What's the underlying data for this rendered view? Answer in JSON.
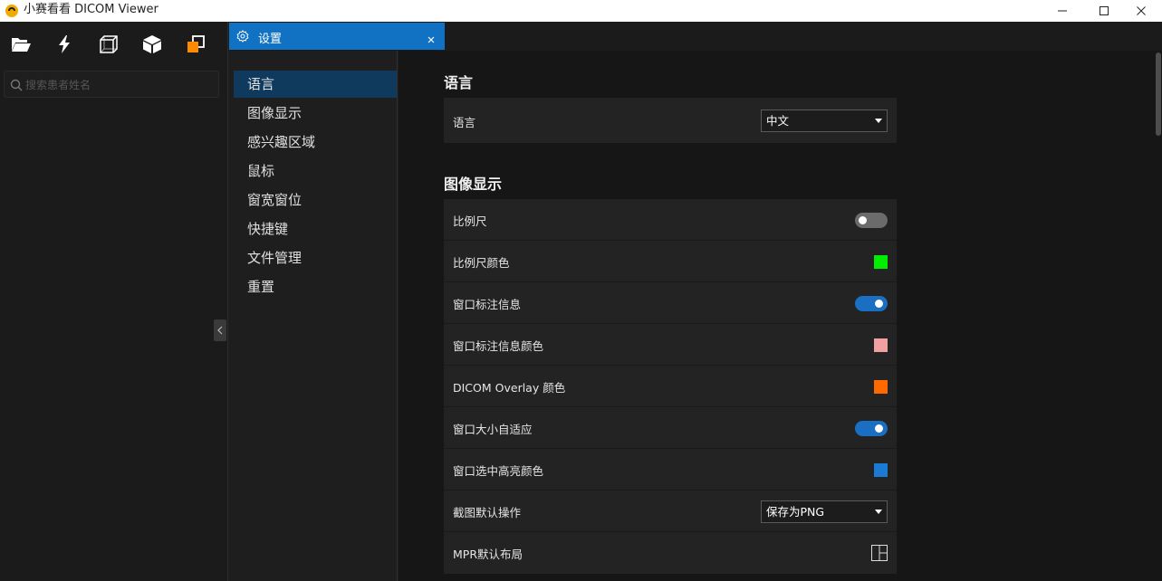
{
  "window": {
    "title": "小赛看看 DICOM Viewer",
    "controls": {
      "minimize": "minimize-icon",
      "maximize": "maximize-icon",
      "close": "close-icon"
    }
  },
  "toolbar": {
    "icons": [
      "folder-open-icon",
      "lightning-icon",
      "cube-wireframe-icon",
      "cube-solid-icon",
      "overlap-squares-icon"
    ]
  },
  "search": {
    "placeholder": "搜索患者姓名",
    "value": ""
  },
  "tab": {
    "label": "设置"
  },
  "nav": {
    "items": [
      {
        "label": "语言",
        "active": true
      },
      {
        "label": "图像显示",
        "active": false
      },
      {
        "label": "感兴趣区域",
        "active": false
      },
      {
        "label": "鼠标",
        "active": false
      },
      {
        "label": "窗宽窗位",
        "active": false
      },
      {
        "label": "快捷键",
        "active": false
      },
      {
        "label": "文件管理",
        "active": false
      },
      {
        "label": "重置",
        "active": false
      }
    ]
  },
  "sections": {
    "language": {
      "title": "语言",
      "rows": [
        {
          "label": "语言",
          "select_value": "中文"
        }
      ]
    },
    "image_display": {
      "title": "图像显示",
      "rows": [
        {
          "label": "比例尺",
          "type": "toggle",
          "on": false
        },
        {
          "label": "比例尺颜色",
          "type": "color",
          "color": "#00ee00"
        },
        {
          "label": "窗口标注信息",
          "type": "toggle",
          "on": true
        },
        {
          "label": "窗口标注信息颜色",
          "type": "color",
          "color": "#f0a0a0"
        },
        {
          "label": "DICOM Overlay 颜色",
          "type": "color",
          "color": "#ff6a00"
        },
        {
          "label": "窗口大小自适应",
          "type": "toggle",
          "on": true
        },
        {
          "label": "窗口选中高亮颜色",
          "type": "color",
          "color": "#1a7ad4"
        },
        {
          "label": "截图默认操作",
          "type": "select",
          "select_value": "保存为PNG"
        },
        {
          "label": "MPR默认布局",
          "type": "layout",
          "icon": "layout-grid-icon"
        }
      ]
    }
  },
  "colors": {
    "accent": "#1172c4",
    "nav_active": "#0f3a5e",
    "background": "#161616",
    "card": "#232323",
    "toolbar_orange": "#ff8a00"
  }
}
